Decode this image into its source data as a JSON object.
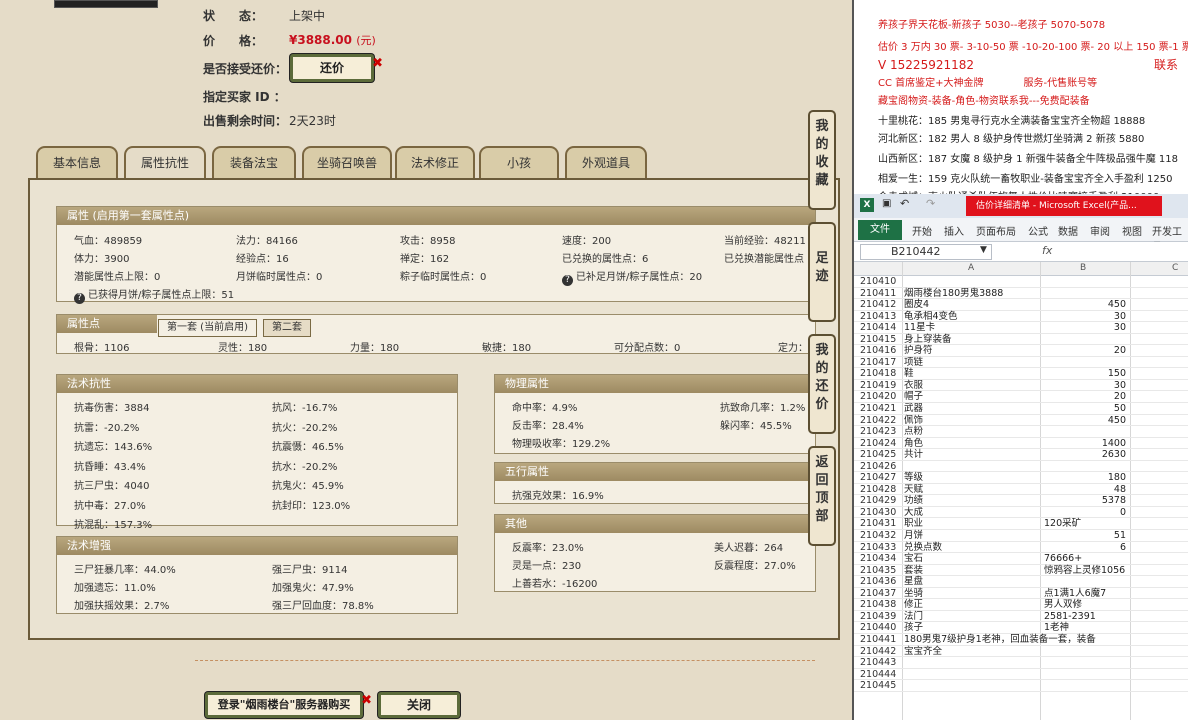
{
  "info": {
    "status_label": "状　　态：",
    "status_value": "上架中",
    "price_label": "价　　格：",
    "price_value": "¥3888.00",
    "price_unit": "(元)",
    "accept_label": "是否接受还价：",
    "counter_btn": "还价",
    "buyer_label": "指定买家 ID ：",
    "remain_label": "出售剩余时间：",
    "remain_value": "2天23时"
  },
  "tabs": [
    "基本信息",
    "属性抗性",
    "装备法宝",
    "坐骑召唤兽",
    "法术修正",
    "小孩",
    "外观道具"
  ],
  "attr": {
    "header": "属性 (启用第一套属性点)",
    "rows": [
      [
        "气血：489859",
        "法力：84166",
        "攻击：8958",
        "速度：200",
        "当前经验：48211"
      ],
      [
        "体力：3900",
        "经验点：16",
        "禅定：162",
        "已兑换的属性点：6",
        "已兑换潜能属性点"
      ],
      [
        "潜能属性点上限：0",
        "月饼临时属性点：0",
        "粽子临时属性点：0",
        "已补足月饼/粽子属性点：20",
        ""
      ]
    ],
    "note": "已获得月饼/粽子属性点上限：51",
    "note2_icon": "?"
  },
  "points": {
    "header": "属性点",
    "tab1": "第一套 (当前启用)",
    "tab2": "第二套",
    "items": [
      "根骨：1106",
      "灵性：180",
      "力量：180",
      "敏捷：180",
      "可分配点数：0",
      "定力："
    ]
  },
  "magic_resist": {
    "header": "法术抗性",
    "left": [
      "抗毒伤害：3884",
      "抗雷：-20.2%",
      "抗遗忘：143.6%",
      "抗昏睡：43.4%",
      "抗三尸虫：4040",
      "抗中毒：27.0%",
      "抗混乱：157.3%"
    ],
    "right": [
      "抗风：-16.7%",
      "抗火：-20.2%",
      "抗震慑：46.5%",
      "抗水：-20.2%",
      "抗鬼火：45.9%",
      "抗封印：123.0%"
    ]
  },
  "magic_boost": {
    "header": "法术增强",
    "left": [
      "三尸狂暴几率：44.0%",
      "加强遗忘：11.0%",
      "加强扶摇效果：2.7%"
    ],
    "right": [
      "强三尸虫：9114",
      "加强鬼火：47.9%",
      "强三尸回血度：78.8%"
    ]
  },
  "physical": {
    "header": "物理属性",
    "left": [
      "命中率：4.9%",
      "反击率：28.4%",
      "物理吸收率：129.2%"
    ],
    "right": [
      "抗致命几率：1.2%",
      "躲闪率：45.5%"
    ]
  },
  "five": {
    "header": "五行属性",
    "items": [
      "抗强克效果：16.9%"
    ]
  },
  "other": {
    "header": "其他",
    "left": [
      "反震率：23.0%",
      "灵是一点：230",
      "上善若水：-16200"
    ],
    "right": [
      "美人迟暮：264",
      "反震程度：27.0%"
    ]
  },
  "side_buttons": [
    [
      "我",
      "的",
      "收",
      "藏"
    ],
    [
      "足",
      "迹"
    ],
    [
      "我",
      "的",
      "还",
      "价"
    ],
    [
      "返",
      "回",
      "顶",
      "部"
    ]
  ],
  "bottom": {
    "login_btn": "登录\"烟雨楼台\"服务器购买",
    "close_btn": "关闭"
  },
  "promo": [
    {
      "t": "养孩子界天花板-新孩子 5030--老孩子 5070-5078",
      "c": "red"
    },
    {
      "t": "估价 3 万内 30 票- 3-10-50 票 -10-20-100 票- 20 以上 150 票-1 票",
      "c": "red"
    },
    {
      "t": "V 15225921182　　　　　　　　　　　　　　　联系",
      "c": "red",
      "big": true
    },
    {
      "t": "CC 首席鉴定+大神金牌　　　　服务-代售账号等",
      "c": "red"
    },
    {
      "t": "藏宝阁物资-装备-角色-物资联系我---免费配装备",
      "c": "red"
    },
    {
      "t": "十里桃花：185 男鬼寻行克水全满装备宝宝齐全物超 18888",
      "c": "black"
    },
    {
      "t": "河北新区：182 男人 8 级护身传世燃灯坐骑满 2 新孩 5880",
      "c": "black"
    },
    {
      "t": "山西新区：187 女魔 8 级护身 1 新强牛装备全牛阵极品强牛魔 118",
      "c": "black"
    },
    {
      "t": "相爱一生：159 克火队统一畜牧职业-装备宝宝齐全入手盈利 1250",
      "c": "black"
    },
    {
      "t": "会走成城：克火队通杀队伍旅舞人性价比哇塞接手盈利 210000",
      "c": "black"
    }
  ],
  "excel": {
    "title": "估价详细清单 - Microsoft Excel(产品...",
    "menu": [
      "文件",
      "开始",
      "插入",
      "页面布局",
      "公式",
      "数据",
      "审阅",
      "视图",
      "开发工具"
    ],
    "cell_ref": "B210442",
    "fx": "fx",
    "cols": [
      "A",
      "B",
      "C"
    ],
    "rows": [
      {
        "n": "210410",
        "a": "",
        "b": ""
      },
      {
        "n": "210411",
        "a": "烟雨楼台180男鬼3888",
        "b": ""
      },
      {
        "n": "210412",
        "a": "圈皮4",
        "b": "450"
      },
      {
        "n": "210413",
        "a": "龟承相4变色",
        "b": "30"
      },
      {
        "n": "210414",
        "a": "11星卡",
        "b": "30"
      },
      {
        "n": "210415",
        "a": "身上穿装备",
        "b": ""
      },
      {
        "n": "210416",
        "a": "护身符",
        "b": "20"
      },
      {
        "n": "210417",
        "a": "项链",
        "b": ""
      },
      {
        "n": "210418",
        "a": "鞋",
        "b": "150"
      },
      {
        "n": "210419",
        "a": "衣服",
        "b": "30"
      },
      {
        "n": "210420",
        "a": "帽子",
        "b": "20"
      },
      {
        "n": "210421",
        "a": "武器",
        "b": "50"
      },
      {
        "n": "210422",
        "a": "佩饰",
        "b": "450"
      },
      {
        "n": "210423",
        "a": "点粉",
        "b": ""
      },
      {
        "n": "210424",
        "a": "角色",
        "b": "1400"
      },
      {
        "n": "210425",
        "a": "共计",
        "b": "2630"
      },
      {
        "n": "210426",
        "a": "",
        "b": ""
      },
      {
        "n": "210427",
        "a": "等级",
        "b": "180"
      },
      {
        "n": "210428",
        "a": "天赋",
        "b": "48"
      },
      {
        "n": "210429",
        "a": "功绩",
        "b": "5378"
      },
      {
        "n": "210430",
        "a": "大成",
        "b": "0"
      },
      {
        "n": "210431",
        "a": "职业",
        "bt": "120采矿"
      },
      {
        "n": "210432",
        "a": "月饼",
        "b": "51"
      },
      {
        "n": "210433",
        "a": "兑换点数",
        "b": "6"
      },
      {
        "n": "210434",
        "a": "宝石",
        "bt": "76666+"
      },
      {
        "n": "210435",
        "a": "套装",
        "bt": "惊鸦容上灵修1056"
      },
      {
        "n": "210436",
        "a": "星盘",
        "b": ""
      },
      {
        "n": "210437",
        "a": "坐骑",
        "bt": "点1满1人6魔7"
      },
      {
        "n": "210438",
        "a": "修正",
        "bt": "男人双修"
      },
      {
        "n": "210439",
        "a": "法门",
        "bt": "2581-2391"
      },
      {
        "n": "210440",
        "a": "孩子",
        "bt": "1老神"
      },
      {
        "n": "210441",
        "a": "180男鬼7级护身1老神，回血装备一套，装备",
        "b": ""
      },
      {
        "n": "210442",
        "a": "宝宝齐全",
        "b": ""
      },
      {
        "n": "210443",
        "a": "",
        "b": ""
      },
      {
        "n": "210444",
        "a": "",
        "b": ""
      },
      {
        "n": "210445",
        "a": "",
        "b": ""
      }
    ]
  }
}
